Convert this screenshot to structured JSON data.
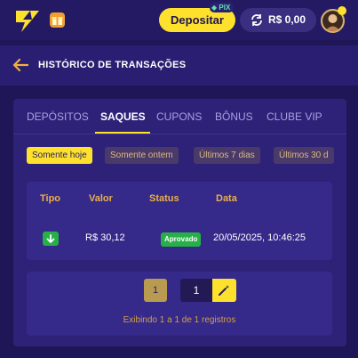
{
  "topbar": {
    "deposit_label": "Depositar",
    "pix_badge": "PIX",
    "balance": "R$ 0,00",
    "avatar_badge": ""
  },
  "header": {
    "title": "HISTÓRICO DE TRANSAÇÕES"
  },
  "tabs": [
    {
      "label": "DEPÓSITOS"
    },
    {
      "label": "SAQUES"
    },
    {
      "label": "CUPONS"
    },
    {
      "label": "BÔNUS"
    },
    {
      "label": "CLUBE VIP"
    }
  ],
  "filters": [
    {
      "label": "Somente hoje"
    },
    {
      "label": "Somente ontem"
    },
    {
      "label": "Últimos 7 dias"
    },
    {
      "label": "Últimos 30 d"
    }
  ],
  "table": {
    "headers": [
      "Tipo",
      "Valor",
      "Status",
      "Data"
    ],
    "rows": [
      {
        "valor": "R$ 30,12",
        "status": "Aprovado",
        "data": "20/05/2025, 10:46:25"
      }
    ]
  },
  "pagination": {
    "current_page": "1",
    "page_input": "1",
    "showing": "Exibindo 1 a 1 de 1 registros"
  },
  "colors": {
    "background": "#1f1658",
    "accent": "#fde12d",
    "success": "#28b048"
  }
}
